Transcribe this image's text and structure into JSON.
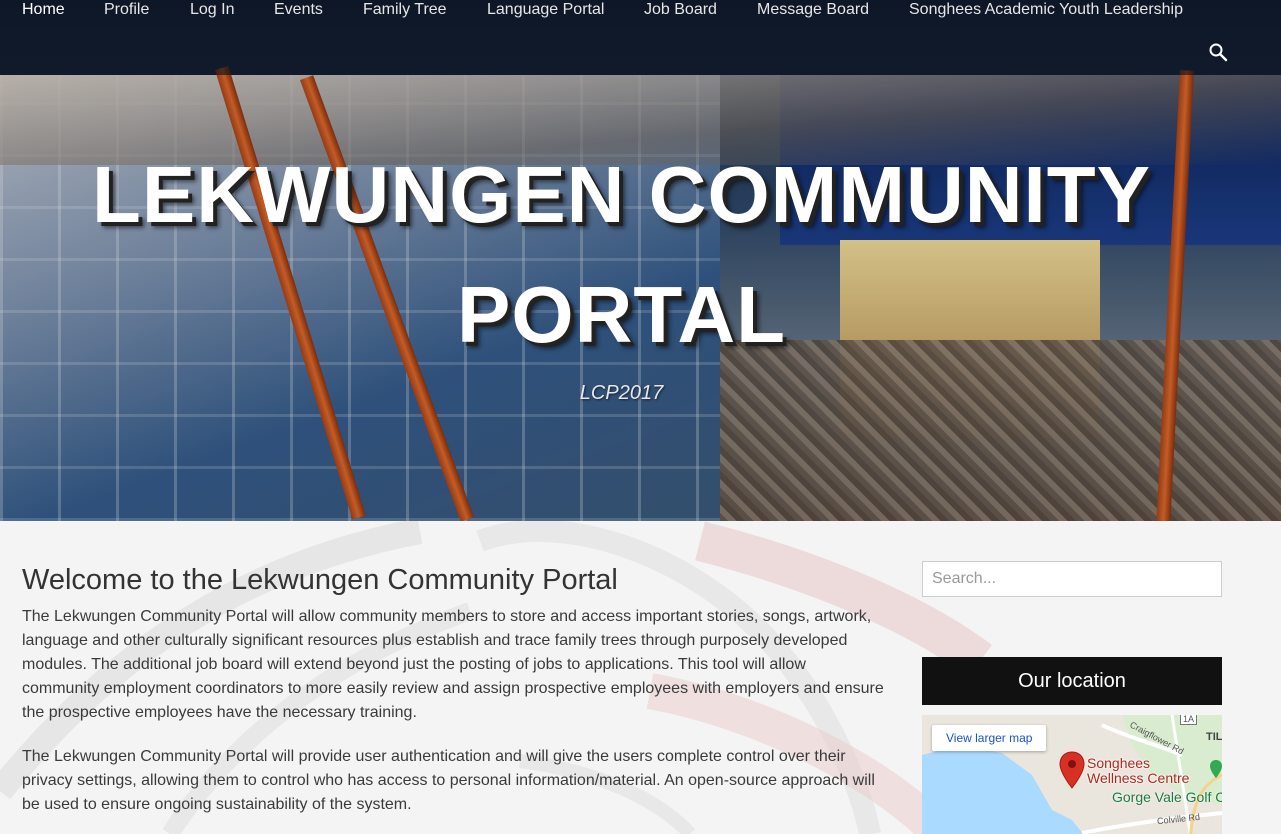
{
  "nav": {
    "items": [
      {
        "label": "Home",
        "active": true
      },
      {
        "label": "Profile"
      },
      {
        "label": "Log In"
      },
      {
        "label": "Events"
      },
      {
        "label": "Family Tree"
      },
      {
        "label": "Language Portal"
      },
      {
        "label": "Job Board"
      },
      {
        "label": "Message Board"
      },
      {
        "label": "Songhees Academic Youth Leadership"
      }
    ],
    "search_icon": "search-icon"
  },
  "hero": {
    "title_line1": "LEKWUNGEN COMMUNITY",
    "title_line2": "PORTAL",
    "tagline": "LCP2017"
  },
  "main": {
    "heading": "Welcome to the Lekwungen Community Portal",
    "paragraphs": [
      "The Lekwungen Community Portal will allow community members to store and access important stories, songs, artwork, language and other culturally significant resources plus establish and trace family trees through purposely developed modules. The additional job board will extend beyond just the posting of jobs to applications. This tool will allow community employment coordinators to more easily review and assign prospective employees with employers and ensure the prospective employees have the necessary training.",
      "The Lekwungen Community Portal will provide user authentication and will give the users complete control over their privacy settings, allowing them to control who has access to personal information/material. An open-source approach will be used to ensure ongoing sustainability of the system."
    ]
  },
  "sidebar": {
    "search_placeholder": "Search...",
    "location_title": "Our location",
    "map": {
      "larger_map_label": "View larger map",
      "place_label": "Songhees Wellness Centre",
      "golf_label": "Gorge Vale Golf C",
      "road_craigflower": "Craigflower Rd",
      "road_colville": "Colville Rd",
      "road_1a": "1A",
      "road_til": "TIL"
    }
  },
  "colors": {
    "nav_bg": "#0a0f19",
    "widget_title_bg": "#111111",
    "map_link": "#1a55c9",
    "map_pin": "#d93025",
    "water": "#aadaff"
  }
}
